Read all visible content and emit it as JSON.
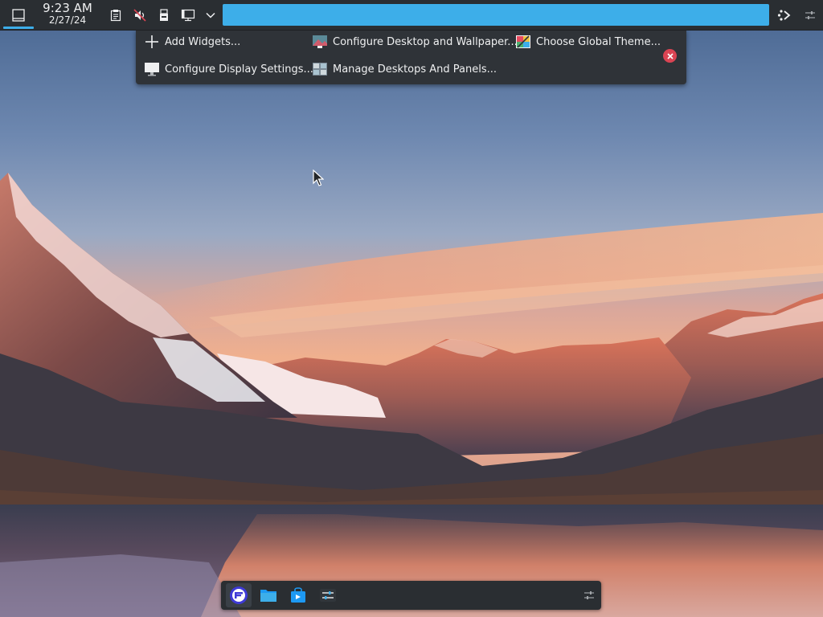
{
  "clock": {
    "time": "9:23 AM",
    "date": "2/27/24"
  },
  "panel": {
    "tray": [
      "clipboard-icon",
      "volume-muted-icon",
      "usb-drive-icon",
      "display-icon",
      "chevron-down-icon"
    ],
    "edit_bar_color": "#3daee9"
  },
  "edit_toolbar": {
    "add_widgets": "Add Widgets...",
    "configure_desktop": "Configure Desktop and Wallpaper...",
    "choose_global_theme": "Choose Global Theme...",
    "configure_display": "Configure Display Settings...",
    "manage_desktops": "Manage Desktops And Panels..."
  },
  "dock": {
    "items": [
      "app-launcher-icon",
      "file-manager-icon",
      "discover-store-icon",
      "system-settings-icon"
    ]
  },
  "colors": {
    "panel": "#2a2e32",
    "accent": "#3daee9",
    "close": "#da4453"
  }
}
